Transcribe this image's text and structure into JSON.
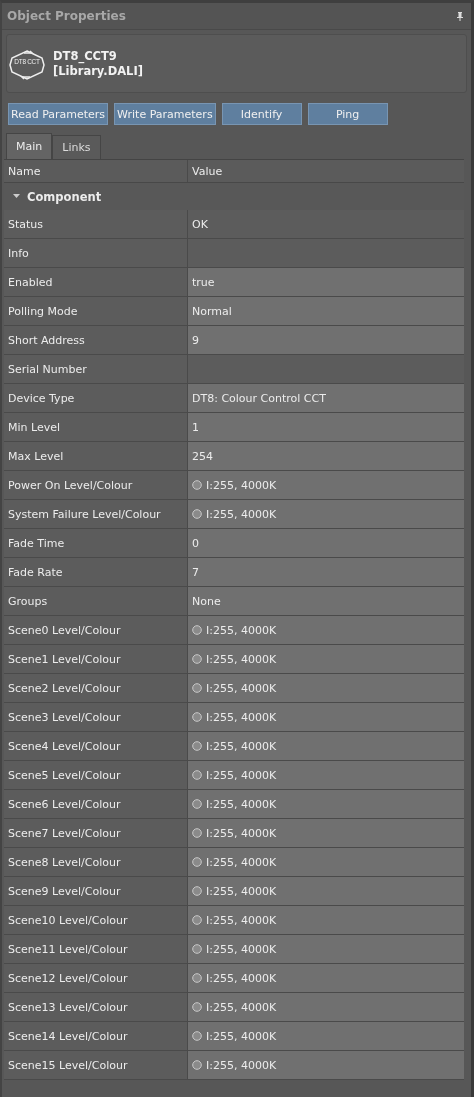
{
  "panel": {
    "title": "Object Properties"
  },
  "object": {
    "icon_label": "DT8 CCT",
    "name": "DT8_CCT9",
    "library": "[Library.DALI]"
  },
  "buttons": [
    "Read Parameters",
    "Write Parameters",
    "Identify",
    "Ping"
  ],
  "tabs": [
    {
      "label": "Main",
      "selected": true
    },
    {
      "label": "Links",
      "selected": false
    }
  ],
  "table": {
    "columns": [
      "Name",
      "Value"
    ],
    "group": {
      "label": "Component",
      "expanded": true
    },
    "rows": [
      {
        "name": "Status",
        "value": "OK",
        "readonly": true,
        "kind": "text"
      },
      {
        "name": "Info",
        "readonly": true,
        "kind": "text"
      },
      {
        "name": "Enabled",
        "value": "true",
        "readonly": false,
        "kind": "text"
      },
      {
        "name": "Polling Mode",
        "value": "Normal",
        "readonly": false,
        "kind": "text"
      },
      {
        "name": "Short Address",
        "value": "9",
        "readonly": false,
        "kind": "text"
      },
      {
        "name": "Serial Number",
        "readonly": true,
        "kind": "text"
      },
      {
        "name": "Device Type",
        "value": "DT8: Colour Control CCT",
        "readonly": false,
        "kind": "text"
      },
      {
        "name": "Min Level",
        "value": "1",
        "readonly": false,
        "kind": "text"
      },
      {
        "name": "Max Level",
        "value": "254",
        "readonly": false,
        "kind": "text"
      },
      {
        "name": "Power On Level/Colour",
        "value": "I:255, 4000K",
        "readonly": false,
        "kind": "colour"
      },
      {
        "name": "System Failure Level/Colour",
        "value": "I:255, 4000K",
        "readonly": false,
        "kind": "colour"
      },
      {
        "name": "Fade Time",
        "value": "0",
        "readonly": false,
        "kind": "text"
      },
      {
        "name": "Fade Rate",
        "value": "7",
        "readonly": false,
        "kind": "text"
      },
      {
        "name": "Groups",
        "value": "None",
        "readonly": false,
        "kind": "text"
      },
      {
        "name": "Scene0 Level/Colour",
        "value": "I:255, 4000K",
        "readonly": false,
        "kind": "colour"
      },
      {
        "name": "Scene1 Level/Colour",
        "value": "I:255, 4000K",
        "readonly": false,
        "kind": "colour"
      },
      {
        "name": "Scene2 Level/Colour",
        "value": "I:255, 4000K",
        "readonly": false,
        "kind": "colour"
      },
      {
        "name": "Scene3 Level/Colour",
        "value": "I:255, 4000K",
        "readonly": false,
        "kind": "colour"
      },
      {
        "name": "Scene4 Level/Colour",
        "value": "I:255, 4000K",
        "readonly": false,
        "kind": "colour"
      },
      {
        "name": "Scene5 Level/Colour",
        "value": "I:255, 4000K",
        "readonly": false,
        "kind": "colour"
      },
      {
        "name": "Scene6 Level/Colour",
        "value": "I:255, 4000K",
        "readonly": false,
        "kind": "colour"
      },
      {
        "name": "Scene7 Level/Colour",
        "value": "I:255, 4000K",
        "readonly": false,
        "kind": "colour"
      },
      {
        "name": "Scene8 Level/Colour",
        "value": "I:255, 4000K",
        "readonly": false,
        "kind": "colour"
      },
      {
        "name": "Scene9 Level/Colour",
        "value": "I:255, 4000K",
        "readonly": false,
        "kind": "colour"
      },
      {
        "name": "Scene10 Level/Colour",
        "value": "I:255, 4000K",
        "readonly": false,
        "kind": "colour"
      },
      {
        "name": "Scene11 Level/Colour",
        "value": "I:255, 4000K",
        "readonly": false,
        "kind": "colour"
      },
      {
        "name": "Scene12 Level/Colour",
        "value": "I:255, 4000K",
        "readonly": false,
        "kind": "colour"
      },
      {
        "name": "Scene13 Level/Colour",
        "value": "I:255, 4000K",
        "readonly": false,
        "kind": "colour"
      },
      {
        "name": "Scene14 Level/Colour",
        "value": "I:255, 4000K",
        "readonly": false,
        "kind": "colour"
      },
      {
        "name": "Scene15 Level/Colour",
        "value": "I:255, 4000K",
        "readonly": false,
        "kind": "colour"
      }
    ]
  }
}
